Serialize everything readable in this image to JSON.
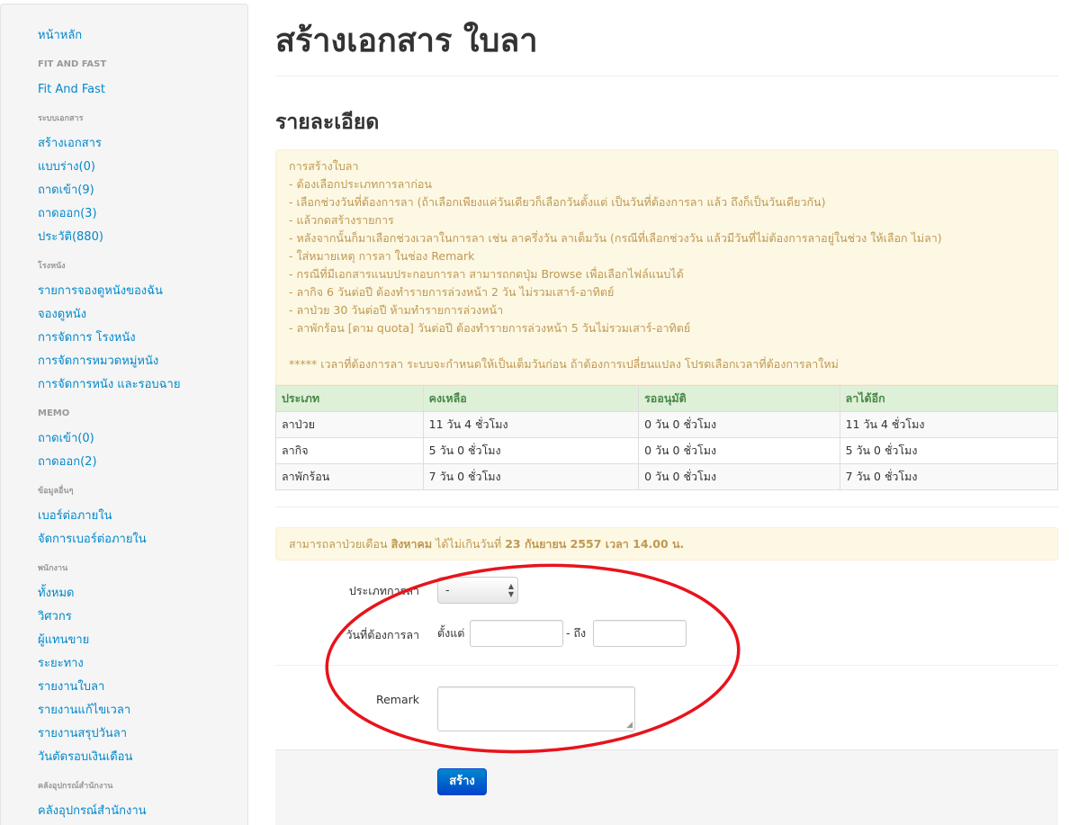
{
  "sidebar": {
    "groups": [
      {
        "header": "",
        "items": [
          "หน้าหลัก"
        ]
      },
      {
        "header": "FIT AND FAST",
        "items": [
          "Fit And Fast"
        ]
      },
      {
        "header": "ระบบเอกสาร",
        "items": [
          "สร้างเอกสาร",
          "แบบร่าง(0)",
          "ถาดเข้า(9)",
          "ถาดออก(3)",
          "ประวัติ(880)"
        ]
      },
      {
        "header": "โรงหนัง",
        "items": [
          "รายการจองดูหนังของฉัน",
          "จองดูหนัง",
          "การจัดการ โรงหนัง",
          "การจัดการหมวดหมู่หนัง",
          "การจัดการหนัง และรอบฉาย"
        ]
      },
      {
        "header": "MEMO",
        "items": [
          "ถาดเข้า(0)",
          "ถาดออก(2)"
        ]
      },
      {
        "header": "ข้อมูลอื่นๆ",
        "items": [
          "เบอร์ต่อภายใน",
          "จัดการเบอร์ต่อภายใน"
        ]
      },
      {
        "header": "พนักงาน",
        "items": [
          "ทั้งหมด",
          "วิศวกร",
          "ผู้แทนขาย",
          "ระยะทาง",
          "รายงานใบลา",
          "รายงานแก้ไขเวลา",
          "รายงานสรุปวันลา",
          "วันตัดรอบเงินเดือน"
        ]
      },
      {
        "header": "คลังอุปกรณ์สำนักงาน",
        "items": [
          "คลังอุปกรณ์สำนักงาน"
        ]
      }
    ]
  },
  "main": {
    "title": "สร้างเอกสาร ใบลา",
    "section_title": "รายละเอียด",
    "info_lines": [
      "การสร้างใบลา",
      "- ต้องเลือกประเภทการลาก่อน",
      "- เลือกช่วงวันที่ต้องการลา (ถ้าเลือกเพียงแค่วันเดียวก็เลือกวันตั้งแต่ เป็นวันที่ต้องการลา แล้ว ถึงก็เป็นวันเดียวกัน)",
      "- แล้วกดสร้างรายการ",
      "- หลังจากนั้นก็มาเลือกช่วงเวลาในการลา เช่น ลาครึ่งวัน ลาเต็มวัน (กรณีที่เลือกช่วงวัน แล้วมีวันที่ไม่ต้องการลาอยู่ในช่วง ให้เลือก ไม่ลา)",
      "- ใส่หมายเหตุ การลา ในช่อง Remark",
      "- กรณีที่มีเอกสารแนบประกอบการลา สามารถกดปุ่ม Browse เพื่อเลือกไฟล์แนบได้",
      "- ลากิจ 6 วันต่อปี ต้องทำรายการล่วงหน้า 2 วัน ไม่รวมเสาร์-อาทิตย์",
      "- ลาป่วย 30 วันต่อปี ห้ามทำรายการล่วงหน้า",
      "- ลาพักร้อน [ตาม quota] วันต่อปี ต้องทำรายการล่วงหน้า 5 วันไม่รวมเสาร์-อาทิตย์"
    ],
    "info_note": "***** เวลาที่ต้องการลา ระบบจะกำหนดให้เป็นเต็มวันก่อน ถ้าต้องการเปลี่ยนแปลง โปรดเลือกเวลาที่ต้องการลาใหม่",
    "table": {
      "headers": [
        "ประเภท",
        "คงเหลือ",
        "รออนุมัติ",
        "ลาได้อีก"
      ],
      "rows": [
        [
          "ลาป่วย",
          "11 วัน 4 ชั่วโมง",
          "0 วัน 0 ชั่วโมง",
          "11 วัน 4 ชั่วโมง"
        ],
        [
          "ลากิจ",
          "5 วัน 0 ชั่วโมง",
          "0 วัน 0 ชั่วโมง",
          "5 วัน 0 ชั่วโมง"
        ],
        [
          "ลาพักร้อน",
          "7 วัน 0 ชั่วโมง",
          "0 วัน 0 ชั่วโมง",
          "7 วัน 0 ชั่วโมง"
        ]
      ]
    },
    "alert": {
      "prefix": "สามารถลาป่วยเดือน ",
      "month": "สิงหาคม",
      "middle": " ได้ไม่เกินวันที่ ",
      "deadline": "23 กันยายน 2557 เวลา 14.00 น."
    },
    "form": {
      "leave_type_label": "ประเภทการลา",
      "leave_type_value": "-",
      "date_label": "วันที่ต้องการลา",
      "from_label": "ตั้งแต่",
      "to_label": "- ถึง",
      "from_value": "",
      "to_value": "",
      "remark_label": "Remark",
      "remark_value": "",
      "submit_label": "สร้าง"
    }
  },
  "annotation": {
    "color": "#e8131b"
  }
}
